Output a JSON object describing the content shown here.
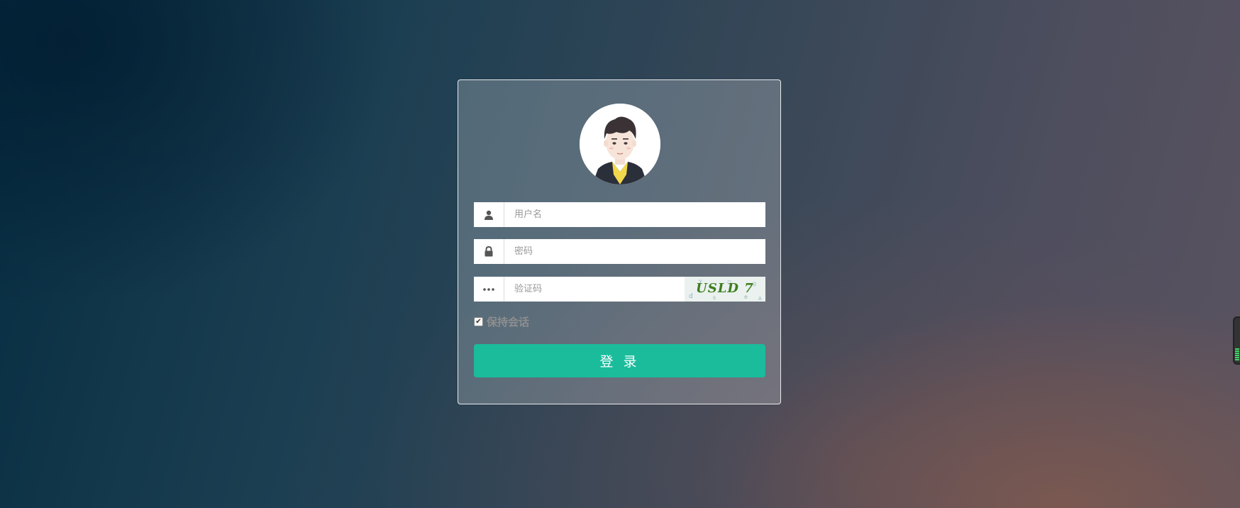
{
  "login": {
    "username_placeholder": "用户名",
    "password_placeholder": "密码",
    "captcha_placeholder": "验证码",
    "captcha_text": "USLD 7",
    "remember_label": "保持会话",
    "remember_checked": true,
    "submit_label": "登 录"
  },
  "icons": {
    "username": "user-icon",
    "password": "lock-icon",
    "captcha": "ellipsis-icon"
  },
  "colors": {
    "accent": "#1abc9c",
    "panel_border": "#ffffff"
  }
}
